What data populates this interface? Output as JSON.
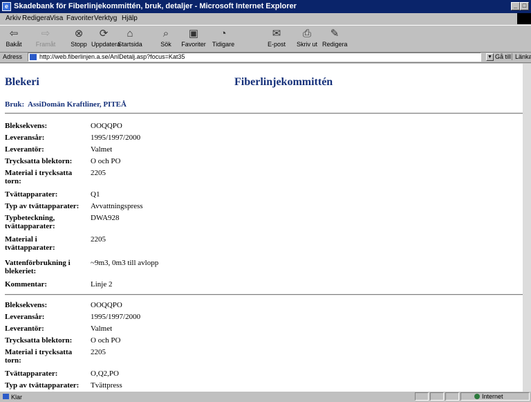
{
  "window": {
    "title": "Skadebank för Fiberlinjekommittén, bruk, detaljer - Microsoft Internet Explorer"
  },
  "menu": [
    "Arkiv",
    "Redigera",
    "Visa",
    "Favoriter",
    "Verktyg",
    "Hjälp"
  ],
  "toolbar": {
    "back": "Bakåt",
    "forward": "Framåt",
    "stop": "Stopp",
    "refresh": "Uppdatera",
    "home": "Startsida",
    "search": "Sök",
    "favorites": "Favoriter",
    "history": "Tidigare",
    "mail": "E-post",
    "print": "Skriv ut",
    "edit": "Redigera"
  },
  "address": {
    "label": "Adress",
    "url": "http://web.fiberlinjen.a.se/AnlDetalj.asp?focus=Kat35",
    "go": "Gå till",
    "links": "Länkar"
  },
  "page": {
    "heading_left": "Blekeri",
    "heading_center": "Fiberlinjekommittén",
    "bruk_label": "Bruk:",
    "bruk_value": "AssiDomän Kraftliner, PITEÅ",
    "sections": [
      {
        "rows": [
          {
            "label": "Bleksekvens:",
            "value": "OOQQPO"
          },
          {
            "label": "Leveransår:",
            "value": "1995/1997/2000"
          },
          {
            "label": "Leverantör:",
            "value": "Valmet"
          },
          {
            "label": "Trycksatta blektorn:",
            "value": "O och PO"
          },
          {
            "label": "Material i trycksatta torn:",
            "value": "2205"
          },
          {
            "label": "Tvättapparater:",
            "value": "Q1"
          },
          {
            "label": "Typ av tvättapparater:",
            "value": "Avvattningspress"
          },
          {
            "label": "Typbeteckning, tvättapparater:",
            "value": "DWA928"
          },
          {
            "label": "Material i tvättapparater:",
            "value": "2205"
          },
          {
            "label": "Vattenförbrukning i blekeriet:",
            "value": "~9m3, 0m3 till avlopp"
          },
          {
            "label": "Kommentar:",
            "value": "Linje 2"
          }
        ]
      },
      {
        "rows": [
          {
            "label": "Bleksekvens:",
            "value": "OOQQPO"
          },
          {
            "label": "Leveransår:",
            "value": "1995/1997/2000"
          },
          {
            "label": "Leverantör:",
            "value": "Valmet"
          },
          {
            "label": "Trycksatta blektorn:",
            "value": "O och PO"
          },
          {
            "label": "Material i trycksatta torn:",
            "value": "2205"
          },
          {
            "label": "Tvättapparater:",
            "value": "O,Q2,PO"
          },
          {
            "label": "Typ av tvättapparater:",
            "value": "Tvättpress"
          }
        ]
      }
    ]
  },
  "status": {
    "text": "Klar",
    "zone": "Internet"
  }
}
